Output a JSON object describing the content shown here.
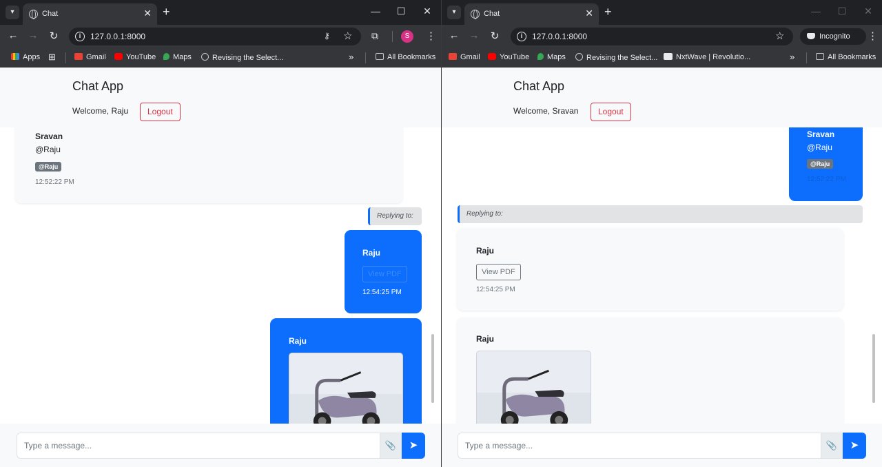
{
  "left": {
    "tab_title": "Chat",
    "url": "127.0.0.1:8000",
    "avatar_letter": "S",
    "bookmarks": [
      "Apps",
      "Gmail",
      "YouTube",
      "Maps",
      "Revising the Select...",
      "All Bookmarks"
    ],
    "app_title": "Chat App",
    "welcome": "Welcome, Raju",
    "logout": "Logout",
    "msg1": {
      "sender": "Sravan",
      "text": "@Raju",
      "mention": "@Raju",
      "time": "12:52:22 PM"
    },
    "replying": "Replying to:",
    "msg2": {
      "sender": "Raju",
      "pdf": "View PDF",
      "time": "12:54:25 PM"
    },
    "msg3": {
      "sender": "Raju"
    },
    "placeholder": "Type a message..."
  },
  "right": {
    "tab_title": "Chat",
    "url": "127.0.0.1:8000",
    "incognito": "Incognito",
    "bookmarks": [
      "Gmail",
      "YouTube",
      "Maps",
      "Revising the Select...",
      "NxtWave | Revolutio...",
      "All Bookmarks"
    ],
    "app_title": "Chat App",
    "welcome": "Welcome, Sravan",
    "logout": "Logout",
    "msg1": {
      "sender": "Sravan",
      "text": "@Raju",
      "mention": "@Raju",
      "time": "12:52:22 PM"
    },
    "replying": "Replying to:",
    "msg2": {
      "sender": "Raju",
      "pdf": "View PDF",
      "time": "12:54:25 PM"
    },
    "msg3": {
      "sender": "Raju"
    },
    "placeholder": "Type a message..."
  },
  "colors": {
    "primary": "#0d6efd",
    "danger": "#dc3545",
    "badge": "#6c757d",
    "chrome_dark": "#202124",
    "chrome": "#35363a"
  },
  "icons": [
    "chevron-down-icon",
    "globe-icon",
    "close-icon",
    "plus-icon",
    "minimize-icon",
    "maximize-icon",
    "back-icon",
    "forward-icon",
    "reload-icon",
    "info-icon",
    "key-icon",
    "star-icon",
    "extensions-icon",
    "kebab-icon",
    "paperclip-icon",
    "send-icon",
    "incognito-icon"
  ]
}
